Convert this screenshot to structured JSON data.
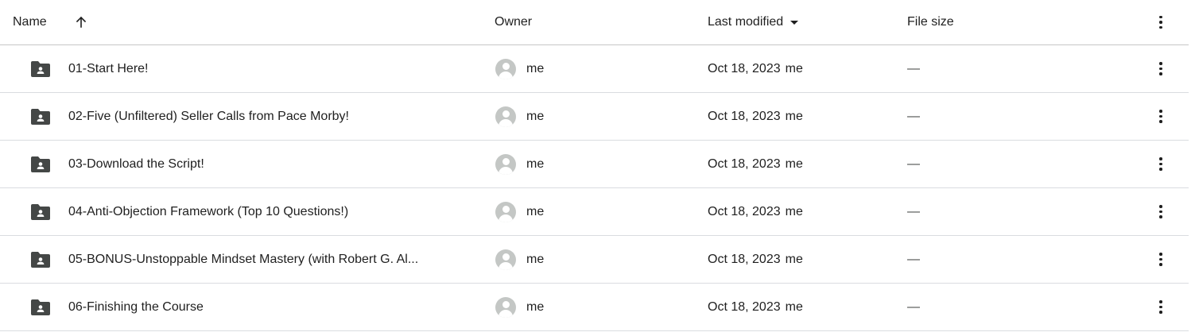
{
  "header": {
    "name_label": "Name",
    "owner_label": "Owner",
    "modified_label": "Last modified",
    "size_label": "File size",
    "sort_icon": "arrow-up-icon",
    "modified_sort_icon": "caret-down-icon",
    "more_icon": "more-vert-icon"
  },
  "rows": [
    {
      "name": "01-Start Here!",
      "owner": "me",
      "modified": "Oct 18, 2023",
      "modified_by": "me",
      "size": "—"
    },
    {
      "name": "02-Five (Unfiltered) Seller Calls from Pace Morby!",
      "owner": "me",
      "modified": "Oct 18, 2023",
      "modified_by": "me",
      "size": "—"
    },
    {
      "name": "03-Download the Script!",
      "owner": "me",
      "modified": "Oct 18, 2023",
      "modified_by": "me",
      "size": "—"
    },
    {
      "name": "04-Anti-Objection Framework (Top 10 Questions!)",
      "owner": "me",
      "modified": "Oct 18, 2023",
      "modified_by": "me",
      "size": "—"
    },
    {
      "name": "05-BONUS-Unstoppable Mindset Mastery (with Robert G. Al...",
      "owner": "me",
      "modified": "Oct 18, 2023",
      "modified_by": "me",
      "size": "—"
    },
    {
      "name": "06-Finishing the Course",
      "owner": "me",
      "modified": "Oct 18, 2023",
      "modified_by": "me",
      "size": "—"
    }
  ],
  "colors": {
    "text": "#1f1f1f",
    "folder_icon": "#444746",
    "avatar": "#c4c7c5",
    "divider": "#dadce0"
  }
}
